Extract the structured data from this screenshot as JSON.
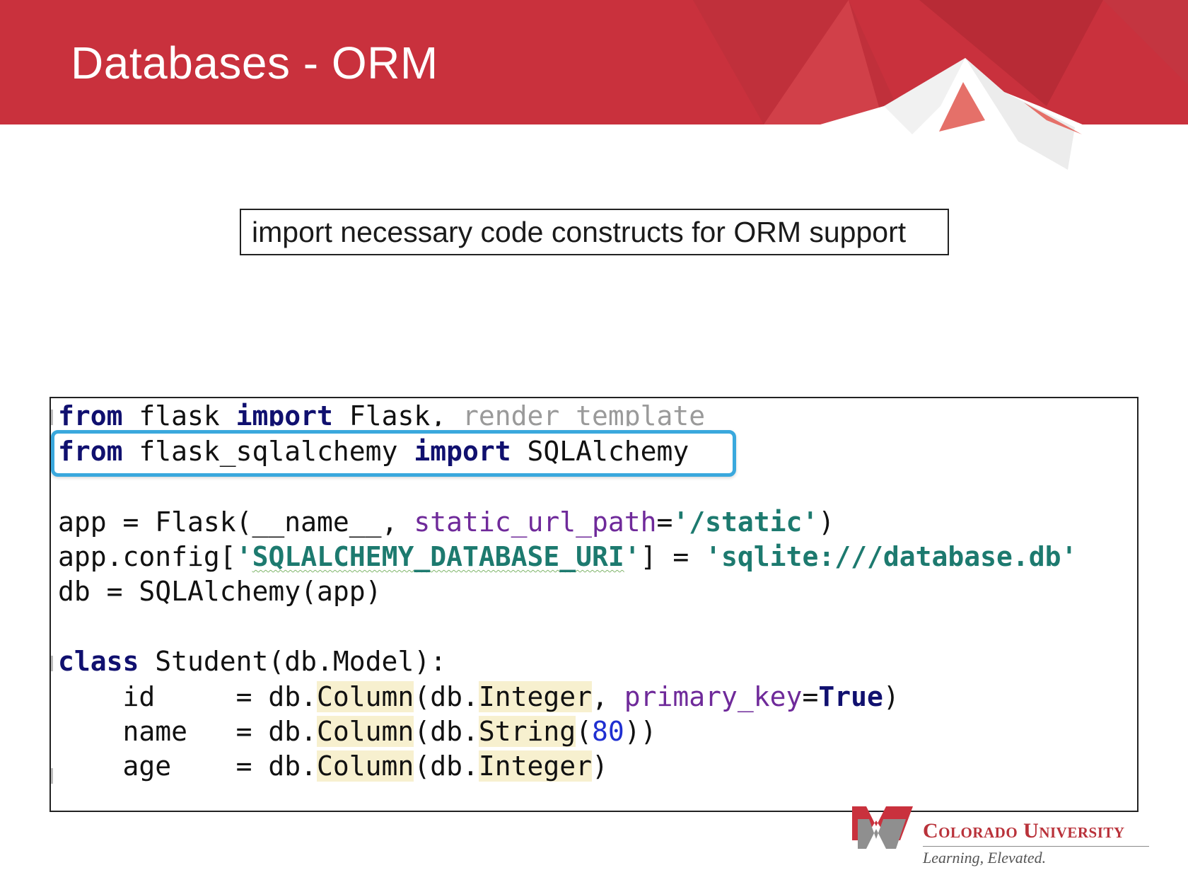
{
  "slide": {
    "title": "Databases - ORM",
    "callout": "import necessary code constructs for ORM support"
  },
  "code": {
    "line1": {
      "k1": "from",
      "t1": " flask ",
      "k2": "import",
      "t2": " Flask, ",
      "t3": "render_template"
    },
    "line2": {
      "k1": "from",
      "t1": " flask_sqlalchemy ",
      "k2": "import",
      "t2": " SQLAlchemy"
    },
    "line4": {
      "t1": "app = Flask(__name__, ",
      "p1": "static_url_path",
      "t2": "=",
      "s1": "'/static'",
      "t3": ")"
    },
    "line5": {
      "t1": "app.config[",
      "s1a": "'",
      "s1b": "SQLALCHEMY_DATABASE_URI",
      "s1c": "'",
      "t2": "] = ",
      "s2": "'sqlite:///database.db'"
    },
    "line6": {
      "t1": "db = SQLAlchemy(app)"
    },
    "line8": {
      "k1": "class",
      "t1": " Student(db.Model):"
    },
    "line9": {
      "t1": "    id     = db.",
      "h1": "Column",
      "t2": "(db.",
      "h2": "Integer",
      "t3": ", ",
      "p1": "primary_key",
      "t4": "=",
      "k1": "True",
      "t5": ")"
    },
    "line10": {
      "t1": "    name   = db.",
      "h1": "Column",
      "t2": "(db.",
      "h2": "String",
      "t3": "(",
      "n1": "80",
      "t4": "))"
    },
    "line11": {
      "t1": "    age    = db.",
      "h1": "Column",
      "t2": "(db.",
      "h2": "Integer",
      "t3": ")"
    }
  },
  "logo": {
    "name": "Colorado University",
    "tagline": "Learning, Elevated."
  },
  "colors": {
    "banner_red": "#c9313d",
    "highlight_blue": "#3aa8dd",
    "keyword": "#10106f",
    "string": "#1d7a6f",
    "param": "#6f2a9a"
  }
}
